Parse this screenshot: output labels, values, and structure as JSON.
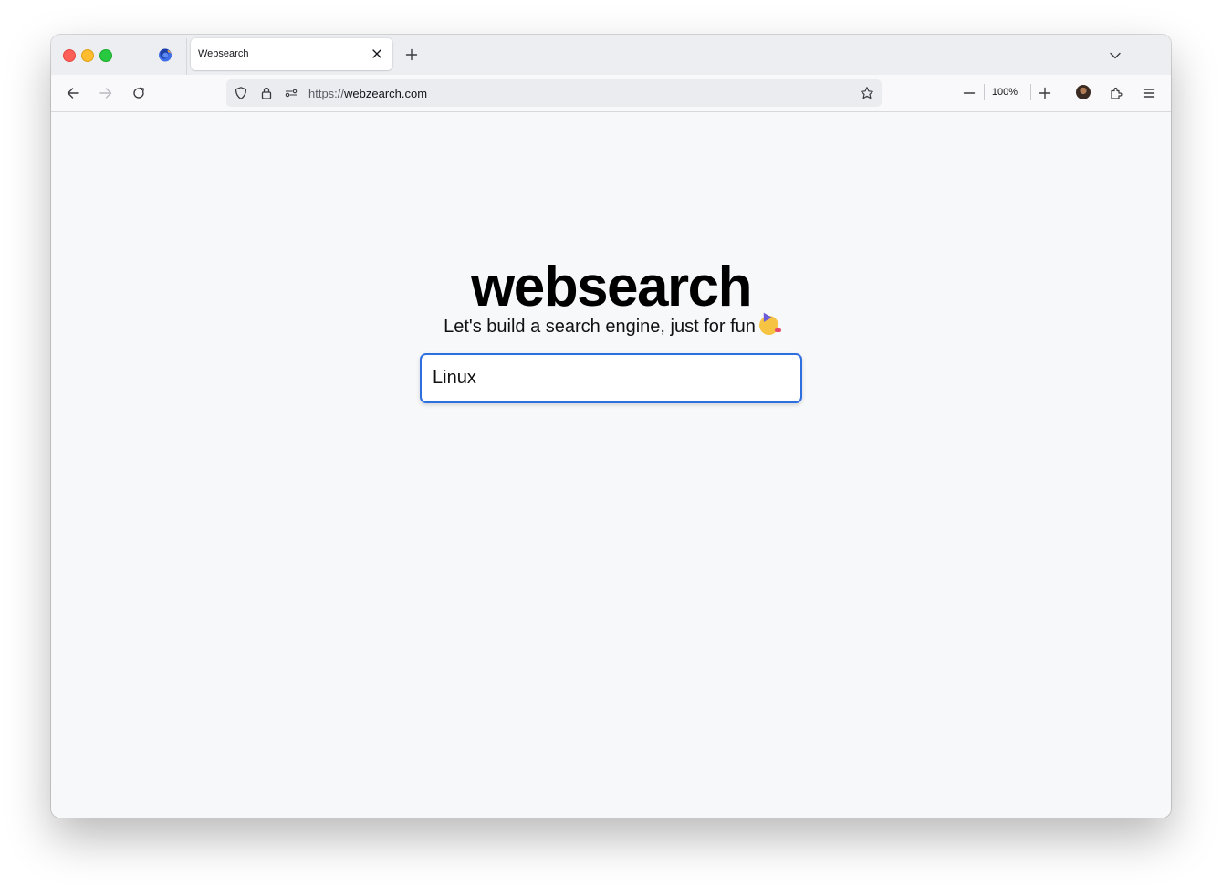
{
  "window": {
    "traffic_lights": [
      "close",
      "minimize",
      "maximize"
    ]
  },
  "tabs": [
    {
      "title": "Websearch",
      "active": true
    }
  ],
  "navbar": {
    "url_scheme": "https://",
    "url_host": "webzearch.com",
    "zoom": "100%"
  },
  "page": {
    "logo": "websearch",
    "tagline": "Let's build a search engine, just for fun",
    "tagline_emoji": "partying-face",
    "search_value": "Linux"
  },
  "colors": {
    "accent": "#2e6fe0",
    "page_bg": "#f7f8fa"
  },
  "icons": [
    "firefox-logo-icon",
    "close-icon",
    "plus-icon",
    "chevron-down-icon",
    "back-arrow-icon",
    "forward-arrow-icon",
    "reload-icon",
    "shield-icon",
    "lock-icon",
    "permissions-icon",
    "star-icon",
    "zoom-out-icon",
    "zoom-in-icon",
    "account-avatar",
    "extensions-icon",
    "hamburger-menu-icon"
  ]
}
